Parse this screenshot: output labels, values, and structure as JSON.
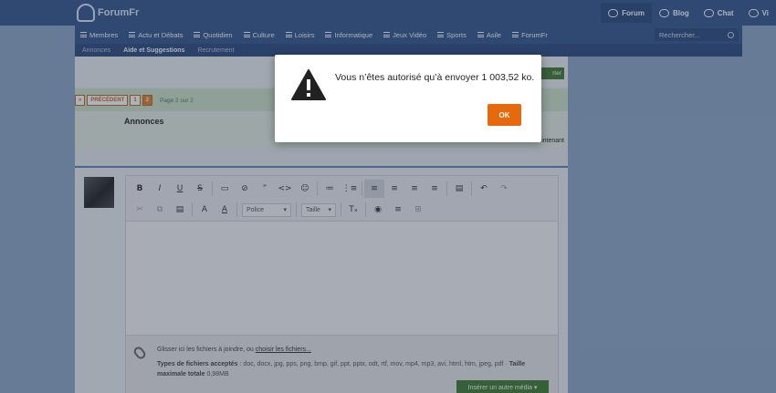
{
  "header": {
    "logo": "ForumFr",
    "links": [
      {
        "label": "Forum"
      },
      {
        "label": "Blog"
      },
      {
        "label": "Chat"
      },
      {
        "label": "Vi"
      }
    ]
  },
  "nav": {
    "items": [
      "Membres",
      "Actu et Débats",
      "Quotidien",
      "Culture",
      "Loisirs",
      "Informatique",
      "Jeux Vidéo",
      "Sports",
      "Asile",
      "ForumFr"
    ],
    "search_placeholder": "Rechercher..."
  },
  "subnav": {
    "items": [
      "Annonces",
      "Aide et Suggestions",
      "Recrutement"
    ],
    "active": "Aide et Suggestions"
  },
  "topic": {
    "reply_label": "rter",
    "pager": {
      "prev": "«",
      "prev_label": "PRÉCÉDENT",
      "pages": [
        "1",
        "2"
      ],
      "current": "2",
      "page_of": "Page 2 sur 2"
    },
    "annonces_label": "Annonces",
    "right_text": "Maintenant"
  },
  "editor": {
    "toolbar_row1": [
      "B",
      "I",
      "U",
      "S",
      "▭",
      "⊘",
      "”",
      "<>",
      "☺",
      "≔",
      "⋮≡",
      "≡",
      "≡",
      "≡",
      "≡",
      "▤",
      "↶",
      "↷"
    ],
    "toolbar_row2_icons": [
      "✂",
      "⧉",
      "▤",
      "A",
      "A"
    ],
    "font_select": "Police",
    "size_select": "Taille",
    "toolbar_row2_tail": [
      "Tₓ",
      "◉",
      "≡",
      "⊞"
    ],
    "attach_text": "Glisser ici les fichiers à joindre, ou",
    "attach_link": "choisir les fichiers...",
    "types_label": "Types de fichiers acceptés",
    "types_value": ": doc, docx, jpg, pps, png, bmp, gif, ppt, pptx, odt, rtf, mov, mp4, mp3, avi, html, htm, jpeg, pdf",
    "max_label": "Taille maximale totale",
    "max_value": "0,98MB",
    "insert_label": "Insérer un autre média ▾"
  },
  "modal": {
    "message": "Vous n’êtes autorisé qu’à envoyer 1 003,52 ko.",
    "ok_label": "OK"
  },
  "colors": {
    "header_blue": "#35588e",
    "ok_orange": "#e66a0c",
    "green_button": "#3f7d2e"
  }
}
